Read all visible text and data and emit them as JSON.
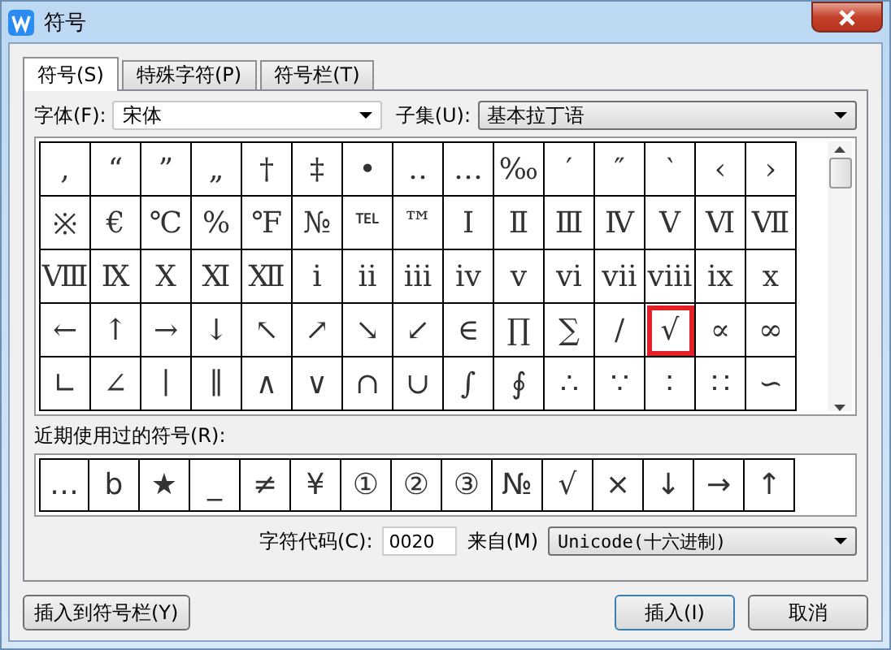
{
  "window": {
    "title": "符号"
  },
  "tabs": [
    {
      "label": "符号(S)",
      "selected": true
    },
    {
      "label": "特殊字符(P)",
      "selected": false
    },
    {
      "label": "符号栏(T)",
      "selected": false
    }
  ],
  "font": {
    "label": "字体(F):",
    "value": "宋体"
  },
  "subset": {
    "label": "子集(U):",
    "value": "基本拉丁语"
  },
  "symbol_grid": [
    [
      {
        "char": ",",
        "selected": false
      },
      {
        "char": "“",
        "selected": false
      },
      {
        "char": "”",
        "selected": false
      },
      {
        "char": "„",
        "selected": false
      },
      {
        "char": "†",
        "selected": false
      },
      {
        "char": "‡",
        "selected": false
      },
      {
        "char": "•",
        "selected": false
      },
      {
        "char": "‥",
        "selected": false
      },
      {
        "char": "…",
        "selected": false
      },
      {
        "char": "‰",
        "selected": false
      },
      {
        "char": "′",
        "selected": false
      },
      {
        "char": "″",
        "selected": false
      },
      {
        "char": "‵",
        "selected": false
      },
      {
        "char": "‹",
        "selected": false
      },
      {
        "char": "›",
        "selected": false
      }
    ],
    [
      {
        "char": "※",
        "selected": false
      },
      {
        "char": "€",
        "selected": false
      },
      {
        "char": "℃",
        "selected": false
      },
      {
        "char": "%",
        "selected": false
      },
      {
        "char": "℉",
        "selected": false
      },
      {
        "char": "№",
        "selected": false
      },
      {
        "char": "℡",
        "selected": false
      },
      {
        "char": "™",
        "selected": false
      },
      {
        "char": "Ⅰ",
        "selected": false
      },
      {
        "char": "Ⅱ",
        "selected": false
      },
      {
        "char": "Ⅲ",
        "selected": false
      },
      {
        "char": "Ⅳ",
        "selected": false
      },
      {
        "char": "Ⅴ",
        "selected": false
      },
      {
        "char": "Ⅵ",
        "selected": false
      },
      {
        "char": "Ⅶ",
        "selected": false
      }
    ],
    [
      {
        "char": "Ⅷ",
        "selected": false
      },
      {
        "char": "Ⅸ",
        "selected": false
      },
      {
        "char": "Ⅹ",
        "selected": false
      },
      {
        "char": "Ⅺ",
        "selected": false
      },
      {
        "char": "Ⅻ",
        "selected": false
      },
      {
        "char": "ⅰ",
        "selected": false
      },
      {
        "char": "ⅱ",
        "selected": false
      },
      {
        "char": "ⅲ",
        "selected": false
      },
      {
        "char": "ⅳ",
        "selected": false
      },
      {
        "char": "ⅴ",
        "selected": false
      },
      {
        "char": "ⅵ",
        "selected": false
      },
      {
        "char": "ⅶ",
        "selected": false
      },
      {
        "char": "ⅷ",
        "selected": false
      },
      {
        "char": "ⅸ",
        "selected": false
      },
      {
        "char": "ⅹ",
        "selected": false
      }
    ],
    [
      {
        "char": "←",
        "selected": false
      },
      {
        "char": "↑",
        "selected": false
      },
      {
        "char": "→",
        "selected": false
      },
      {
        "char": "↓",
        "selected": false
      },
      {
        "char": "↖",
        "selected": false
      },
      {
        "char": "↗",
        "selected": false
      },
      {
        "char": "↘",
        "selected": false
      },
      {
        "char": "↙",
        "selected": false
      },
      {
        "char": "∈",
        "selected": false
      },
      {
        "char": "∏",
        "selected": false
      },
      {
        "char": "∑",
        "selected": false
      },
      {
        "char": "∕",
        "selected": false
      },
      {
        "char": "√",
        "selected": true
      },
      {
        "char": "∝",
        "selected": false
      },
      {
        "char": "∞",
        "selected": false
      }
    ],
    [
      {
        "char": "∟",
        "selected": false
      },
      {
        "char": "∠",
        "selected": false
      },
      {
        "char": "∣",
        "selected": false
      },
      {
        "char": "∥",
        "selected": false
      },
      {
        "char": "∧",
        "selected": false
      },
      {
        "char": "∨",
        "selected": false
      },
      {
        "char": "∩",
        "selected": false
      },
      {
        "char": "∪",
        "selected": false
      },
      {
        "char": "∫",
        "selected": false
      },
      {
        "char": "∮",
        "selected": false
      },
      {
        "char": "∴",
        "selected": false
      },
      {
        "char": "∵",
        "selected": false
      },
      {
        "char": "∶",
        "selected": false
      },
      {
        "char": "∷",
        "selected": false
      },
      {
        "char": "∽",
        "selected": false
      }
    ]
  ],
  "recent": {
    "label": "近期使用过的符号(R):",
    "symbols": [
      "…",
      "b",
      "★",
      "_",
      "≠",
      "¥",
      "①",
      "②",
      "③",
      "№",
      "√",
      "×",
      "↓",
      "→",
      "↑"
    ]
  },
  "char_code": {
    "label": "字符代码(C):",
    "value": "0020"
  },
  "from": {
    "label": "来自(M)",
    "value": "Unicode(十六进制)"
  },
  "buttons": {
    "add_to_bar": "插入到符号栏(Y)",
    "insert": "插入(I)",
    "cancel": "取消"
  }
}
